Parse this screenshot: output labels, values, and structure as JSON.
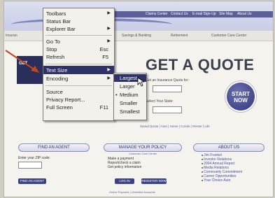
{
  "header": {
    "nav_links": [
      "Claims Center",
      "Contact Us",
      "E-mail Sign-Up",
      "Site Map",
      "About Us"
    ]
  },
  "topnav": {
    "items": [
      "Insurance",
      "Savings & Banking",
      "Retirement",
      "Customer Care Center"
    ],
    "insurance_partial": "Insuran"
  },
  "menu": {
    "items": [
      {
        "label": "Toolbars",
        "shortcut": "",
        "arrow": "▶"
      },
      {
        "label": "Status Bar",
        "shortcut": "",
        "arrow": ""
      },
      {
        "label": "Explorer Bar",
        "shortcut": "",
        "arrow": "▶"
      },
      {
        "label": "Go To",
        "shortcut": "",
        "arrow": "▶"
      },
      {
        "label": "Stop",
        "shortcut": "Esc",
        "arrow": ""
      },
      {
        "label": "Refresh",
        "shortcut": "F5",
        "arrow": ""
      },
      {
        "label": "Text Size",
        "shortcut": "",
        "arrow": "▶"
      },
      {
        "label": "Encoding",
        "shortcut": "",
        "arrow": "▶"
      },
      {
        "label": "Source",
        "shortcut": "",
        "arrow": ""
      },
      {
        "label": "Privacy Report...",
        "shortcut": "",
        "arrow": ""
      },
      {
        "label": "Full Screen",
        "shortcut": "F11",
        "arrow": ""
      }
    ],
    "highlighted": "Text Size"
  },
  "text_size_submenu": {
    "items": [
      "Largest",
      "Larger",
      "Medium",
      "Smaller",
      "Smallest"
    ],
    "highlighted": "Largest",
    "selected": "Medium",
    "selected_marker": "•"
  },
  "quote": {
    "title": "GET A QUOTE",
    "line1": "Get an Insurance Quote for:",
    "line2": "Select Your State:",
    "start_line1": "START",
    "start_line2": "NOW",
    "links": "Saved Quote | Auto | Home | Condo | Renter | Life"
  },
  "find_agent": {
    "title": "FIND AN AGENT",
    "prompt": "Enter your ZIP code:",
    "button": "FIND AN AGENT"
  },
  "manage_policy": {
    "title": "MANAGE YOUR POLICY",
    "subtitle": "Customer Care Center",
    "lines": [
      "Make a payment",
      "Report/check a claim",
      "Get policy information"
    ],
    "login": "LOG IN",
    "register": "REGISTER NOW",
    "footer": "Online Payment | Unlimited Accounts"
  },
  "about_us": {
    "title": "ABOUT US",
    "items": [
      "Jim Frankel",
      "Investor Relations",
      "2004 Annual Report",
      "Media Relations",
      "Community Commitment",
      "Career Opportunities",
      "Your Choice Auto"
    ]
  },
  "promo": {
    "text": "GET"
  }
}
